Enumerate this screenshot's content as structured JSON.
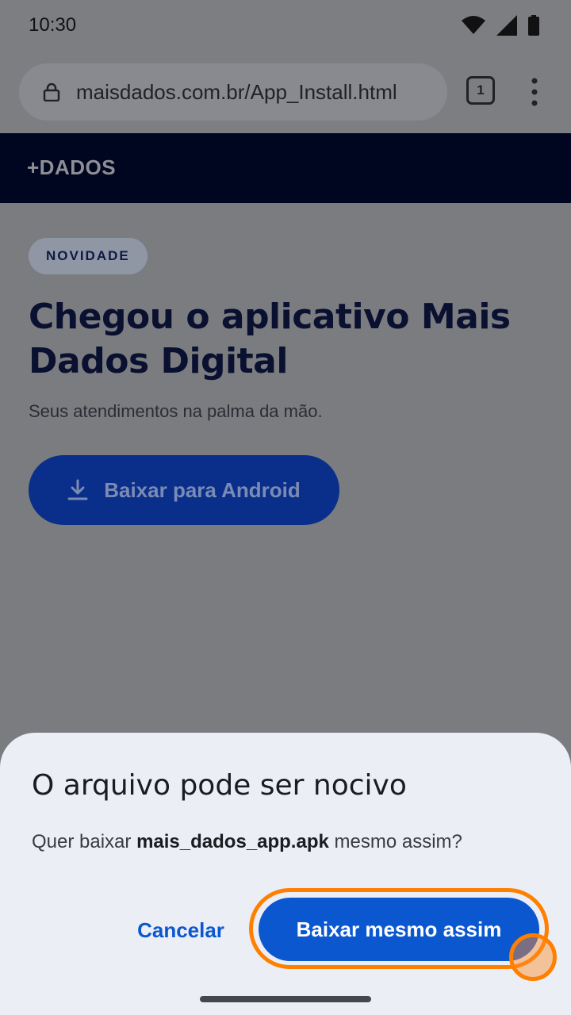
{
  "status_bar": {
    "time": "10:30",
    "icons": [
      "wifi-icon",
      "signal-icon",
      "battery-icon"
    ]
  },
  "browser": {
    "url": "maisdados.com.br/App_Install.html",
    "tab_count": "1",
    "icons": [
      "lock-icon",
      "more-vert-icon"
    ]
  },
  "site": {
    "logo": "+DADOS"
  },
  "page": {
    "badge": "NOVIDADE",
    "headline": "Chegou o aplicativo Mais Dados Digital",
    "subtitle": "Seus atendimentos na palma da mão.",
    "download_button": "Baixar para Android",
    "download_icon": "download-icon"
  },
  "dialog": {
    "title": "O arquivo pode ser nocivo",
    "body_prefix": "Quer baixar ",
    "filename": "mais_dados_app.apk",
    "body_suffix": " mesmo assim?",
    "cancel_label": "Cancelar",
    "confirm_label": "Baixar mesmo assim"
  },
  "colors": {
    "accent": "#0b57d0",
    "highlight": "#ff7f00",
    "header_bg": "#000520"
  }
}
